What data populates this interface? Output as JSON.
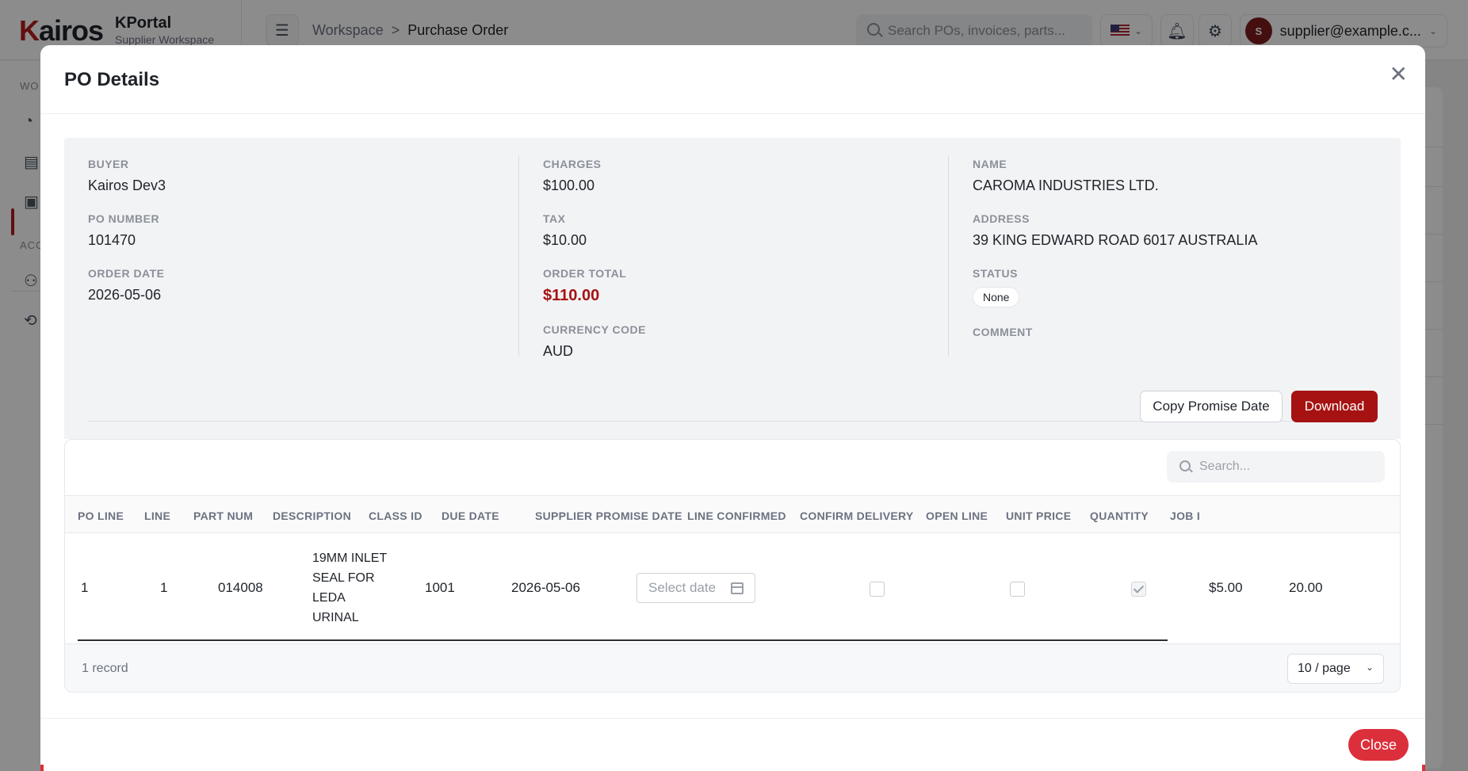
{
  "app": {
    "logo": "Kairos",
    "title": "KPortal",
    "subtitle": "Supplier Workspace"
  },
  "breadcrumb": {
    "root": "Workspace",
    "separator": ">",
    "current": "Purchase Order"
  },
  "topbar": {
    "search_placeholder": "Search POs, invoices, parts...",
    "user_email": "supplier@example.c...",
    "avatar_initial": "S"
  },
  "sidebar": {
    "section1": "WO",
    "section2": "ACC"
  },
  "modal": {
    "title": "PO Details",
    "buyer_label": "BUYER",
    "buyer": "Kairos Dev3",
    "po_number_label": "PO NUMBER",
    "po_number": "101470",
    "order_date_label": "ORDER DATE",
    "order_date": "2026-05-06",
    "charges_label": "CHARGES",
    "charges": "$100.00",
    "tax_label": "TAX",
    "tax": "$10.00",
    "order_total_label": "ORDER TOTAL",
    "order_total": "$110.00",
    "currency_label": "CURRENCY CODE",
    "currency": "AUD",
    "name_label": "NAME",
    "name": "CAROMA INDUSTRIES LTD.",
    "address_label": "ADDRESS",
    "address": "39 KING EDWARD ROAD 6017 AUSTRALIA",
    "status_label": "STATUS",
    "status": "None",
    "comment_label": "COMMENT",
    "copy_button": "Copy Promise Date",
    "download_button": "Download",
    "close_button": "Close"
  },
  "table": {
    "search_placeholder": "Search...",
    "columns": [
      "PO LINE",
      "LINE",
      "PART NUM",
      "DESCRIPTION",
      "CLASS ID",
      "DUE DATE",
      "SUPPLIER PROMISE DATE",
      "LINE CONFIRMED",
      "CONFIRM DELIVERY",
      "OPEN LINE",
      "UNIT PRICE",
      "QUANTITY",
      "JOB I"
    ],
    "rows": [
      {
        "po_line": "1",
        "line": "1",
        "part_num": "014008",
        "description": [
          "19MM INLET",
          "SEAL FOR",
          "LEDA",
          "URINAL"
        ],
        "class_id": "1001",
        "due_date": "2026-05-06",
        "promise_date_placeholder": "Select date",
        "line_confirmed": false,
        "confirm_delivery": false,
        "open_line": true,
        "unit_price": "$5.00",
        "quantity": "20.00"
      }
    ],
    "record_count": "1 record",
    "page_size": "10 / page"
  },
  "colors": {
    "brand": "#b41d1d",
    "accent": "#a61212",
    "close": "#dc2f3c"
  }
}
